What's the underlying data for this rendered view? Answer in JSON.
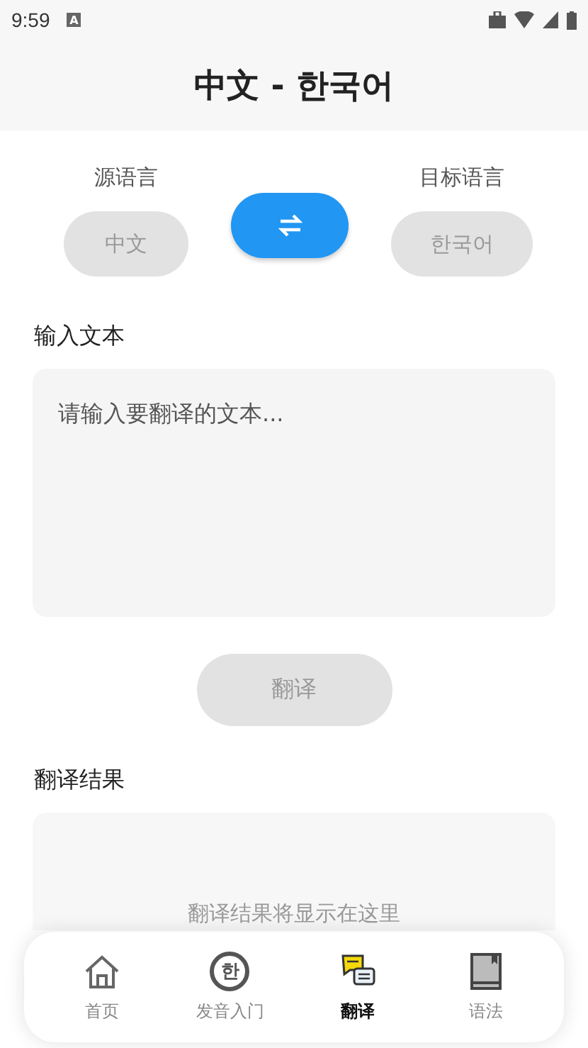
{
  "status_bar": {
    "time": "9:59",
    "notification_glyph": "A"
  },
  "header": {
    "title": "中文 - 한국어"
  },
  "languages": {
    "source_label": "源语言",
    "source": "中文",
    "target_label": "目标语言",
    "target": "한국어"
  },
  "input": {
    "label": "输入文本",
    "placeholder": "请输入要翻译的文本..."
  },
  "translate_button": {
    "label": "翻译",
    "disabled": true
  },
  "result": {
    "label": "翻译结果",
    "placeholder": "翻译结果将显示在这里"
  },
  "nav": [
    {
      "kind": "home",
      "label": "首页",
      "selected": false
    },
    {
      "kind": "hangul",
      "label": "发音入门",
      "glyph": "한",
      "selected": false
    },
    {
      "kind": "translate",
      "label": "翻译",
      "selected": true
    },
    {
      "kind": "book",
      "label": "语法",
      "selected": false
    }
  ]
}
